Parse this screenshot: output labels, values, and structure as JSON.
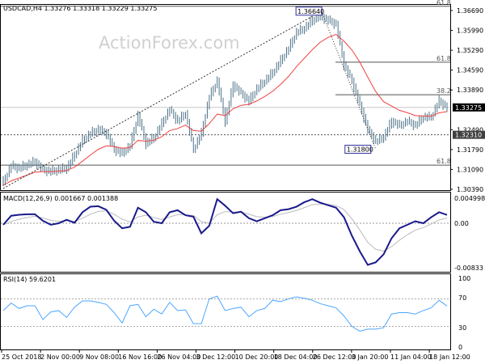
{
  "header": {
    "symbol_ohlc": "USDCAD,H4  1.33276 1.33318 1.33229 1.33275"
  },
  "watermark": "ActionForex.com",
  "colors": {
    "bars": "#4d7288",
    "ma": "#f04040",
    "macd": "#1a1a8c",
    "macd_signal": "#bbbbbb",
    "rsi": "#4da6ff",
    "current_price_tag": "#000000",
    "level_tag": "#404040"
  },
  "chart_data": [
    {
      "type": "ohlc",
      "title": "USDCAD,H4",
      "price_axis_ticks": [
        "1.36690",
        "1.35990",
        "1.35290",
        "1.34590",
        "1.33890",
        "1.32490",
        "1.31790",
        "1.31090",
        "1.30390"
      ],
      "ylim": [
        1.3039,
        1.3669
      ],
      "x_tick_labels": [
        "25 Oct 2018",
        "2 Nov 00:00",
        "9 Nov 08:00",
        "16 Nov 16:00",
        "26 Nov 04:00",
        "3 Dec 12:00",
        "10 Dec 20:00",
        "18 Dec 04:00",
        "26 Dec 12:00",
        "3 Jan 20:00",
        "11 Jan 04:00",
        "18 Jan 12:00"
      ],
      "closes": [
        1.3065,
        1.3122,
        1.3113,
        1.3125,
        1.3136,
        1.3108,
        1.3102,
        1.3108,
        1.3113,
        1.316,
        1.321,
        1.3236,
        1.325,
        1.3236,
        1.3179,
        1.3165,
        1.3193,
        1.33,
        1.32,
        1.322,
        1.327,
        1.332,
        1.3279,
        1.3307,
        1.3179,
        1.3236,
        1.3364,
        1.3421,
        1.3279,
        1.3407,
        1.3378,
        1.335,
        1.3393,
        1.342,
        1.345,
        1.3492,
        1.3535,
        1.3592,
        1.3606,
        1.3635,
        1.3649,
        1.3635,
        1.3621,
        1.3478,
        1.3421,
        1.3336,
        1.325,
        1.3207,
        1.3222,
        1.3279,
        1.3264,
        1.3279,
        1.3264,
        1.3293,
        1.3293,
        1.335,
        1.33275
      ],
      "current_price": {
        "value": 1.33275,
        "label": "1.33275"
      },
      "support_level": {
        "value": 1.3231,
        "label": "1.32310"
      },
      "annotations": {
        "high": {
          "value": 1.3664,
          "label": "1.36640"
        },
        "low": {
          "value": 1.318,
          "label": "1.31800"
        }
      },
      "fib_levels": [
        {
          "label": "61.8",
          "value": 1.3684
        },
        {
          "label": "61.8",
          "value": 1.3487
        },
        {
          "label": "38.2",
          "value": 1.3372
        },
        {
          "label": "61.8",
          "value": 1.3124
        }
      ]
    },
    {
      "type": "line",
      "title": "MACD(12,26,9) 0.001667 0.001388",
      "axis_ticks": [
        "0.004998",
        "0.00",
        "-0.00833"
      ],
      "ylim": [
        -0.0087,
        0.0055
      ],
      "values": [
        -0.0003,
        0.0015,
        0.0017,
        0.0018,
        0.0018,
        0.0005,
        -0.0003,
        0,
        0.0007,
        0.0001,
        0.0022,
        0.0033,
        0.0034,
        0.0027,
        0.0005,
        -0.001,
        -0.0007,
        0.0031,
        0.0022,
        0.0003,
        0,
        0.0022,
        0.0026,
        0.0016,
        0.0013,
        -0.002,
        -0.0005,
        0.0048,
        0.0035,
        0.002,
        0.0023,
        0.001,
        0.0004,
        0.001,
        0.0016,
        0.0026,
        0.0028,
        0.0033,
        0.0042,
        0.0048,
        0.0041,
        0.0036,
        0.0031,
        0.0012,
        -0.0025,
        -0.0056,
        -0.0083,
        -0.0078,
        -0.0062,
        -0.003,
        -0.001,
        -0.0003,
        0.0004,
        0,
        0.0012,
        0.0022,
        0.00167
      ]
    },
    {
      "type": "line",
      "title": "RSI(14) 59.6201",
      "axis_ticks": [
        "100",
        "70",
        "30",
        "0"
      ],
      "ylim": [
        0,
        100
      ],
      "levels": [
        70,
        30
      ],
      "values": [
        53,
        64,
        56,
        60,
        60,
        40,
        51,
        53,
        43,
        58,
        67,
        67,
        65,
        62,
        50,
        35,
        60,
        62,
        44,
        55,
        48,
        65,
        53,
        54,
        34,
        34,
        70,
        74,
        53,
        56,
        58,
        44,
        53,
        56,
        68,
        66,
        70,
        73,
        71,
        68,
        63,
        60,
        57,
        45,
        30,
        23,
        26,
        26,
        28,
        48,
        50,
        50,
        48,
        53,
        57,
        68,
        59.6
      ]
    }
  ]
}
